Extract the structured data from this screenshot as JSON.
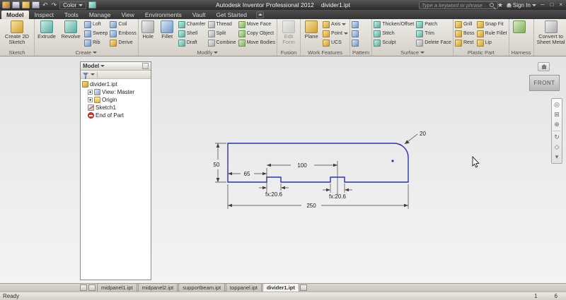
{
  "titlebar": {
    "app_title": "Autodesk Inventor Professional 2012",
    "document": "divider1.ipt",
    "color_dropdown": "Color",
    "search_placeholder": "Type a keyword or phrase",
    "sign_in": "Sign In"
  },
  "icons": {
    "undo": "↶",
    "redo": "↷",
    "star": "★",
    "minimize": "─",
    "maximize": "□",
    "close": "×",
    "nav": [
      "◎",
      "⊞",
      "⊕",
      "↻",
      "◇"
    ],
    "nav_more": "▾"
  },
  "ribbon": {
    "tabs": [
      "Model",
      "Inspect",
      "Tools",
      "Manage",
      "View",
      "Environments",
      "Vault",
      "Get Started"
    ],
    "active_tab": "Model",
    "groups": {
      "sketch": {
        "label": "Sketch",
        "create2d": "Create 2D Sketch"
      },
      "create": {
        "label": "Create",
        "extrude": "Extrude",
        "revolve": "Revolve",
        "col1": [
          "Loft",
          "Sweep",
          "Rib"
        ],
        "col2": [
          "Coil",
          "Emboss",
          "Derive"
        ]
      },
      "modify": {
        "label": "Modify",
        "hole": "Hole",
        "fillet": "Fillet",
        "col1": [
          "Chamfer",
          "Shell",
          "Draft"
        ],
        "col2": [
          "Thread",
          "Split",
          "Combine"
        ],
        "col3": [
          "Move Face",
          "Copy Object",
          "Move Bodies"
        ]
      },
      "fusion": {
        "label": "Fusion",
        "edit_form": "Edit Form"
      },
      "work": {
        "label": "Work Features",
        "plane": "Plane",
        "col": [
          "Axis",
          "Point",
          "UCS"
        ]
      },
      "pattern": {
        "label": "Pattern"
      },
      "surface": {
        "label": "Surface",
        "col1": [
          "Thicken/Offset",
          "Stitch",
          "Sculpt"
        ],
        "col2": [
          "Patch",
          "Trim",
          "Delete Face"
        ]
      },
      "plastic": {
        "label": "Plastic Part",
        "col1": [
          "Grill",
          "Boss",
          "Rest"
        ],
        "col2": [
          "Snap Fit",
          "Rule Fillet",
          "Lip"
        ]
      },
      "harness": {
        "label": "Harness"
      },
      "convert": {
        "label": "",
        "convert": "Convert to Sheet Metal"
      }
    }
  },
  "browser": {
    "title": "Model",
    "tree": [
      {
        "label": "divider1.ipt"
      },
      {
        "label": "View: Master"
      },
      {
        "label": "Origin"
      },
      {
        "label": "Sketch1"
      },
      {
        "label": "End of Part"
      }
    ]
  },
  "canvas": {
    "viewcube": "FRONT",
    "dims": {
      "height": "50",
      "seg1": "65",
      "seg2": "100",
      "overall": "250",
      "radius": "20",
      "fx_left": "fx:20.6",
      "fx_right": "fx:20.6"
    }
  },
  "docbar": {
    "tabs": [
      "midpanel1.ipt",
      "midpanel2.ipt",
      "supportbeam.ipt",
      "toppanel.ipt",
      "divider1.ipt"
    ]
  },
  "statusbar": {
    "message": "Ready",
    "num1": "1",
    "num2": "6"
  }
}
